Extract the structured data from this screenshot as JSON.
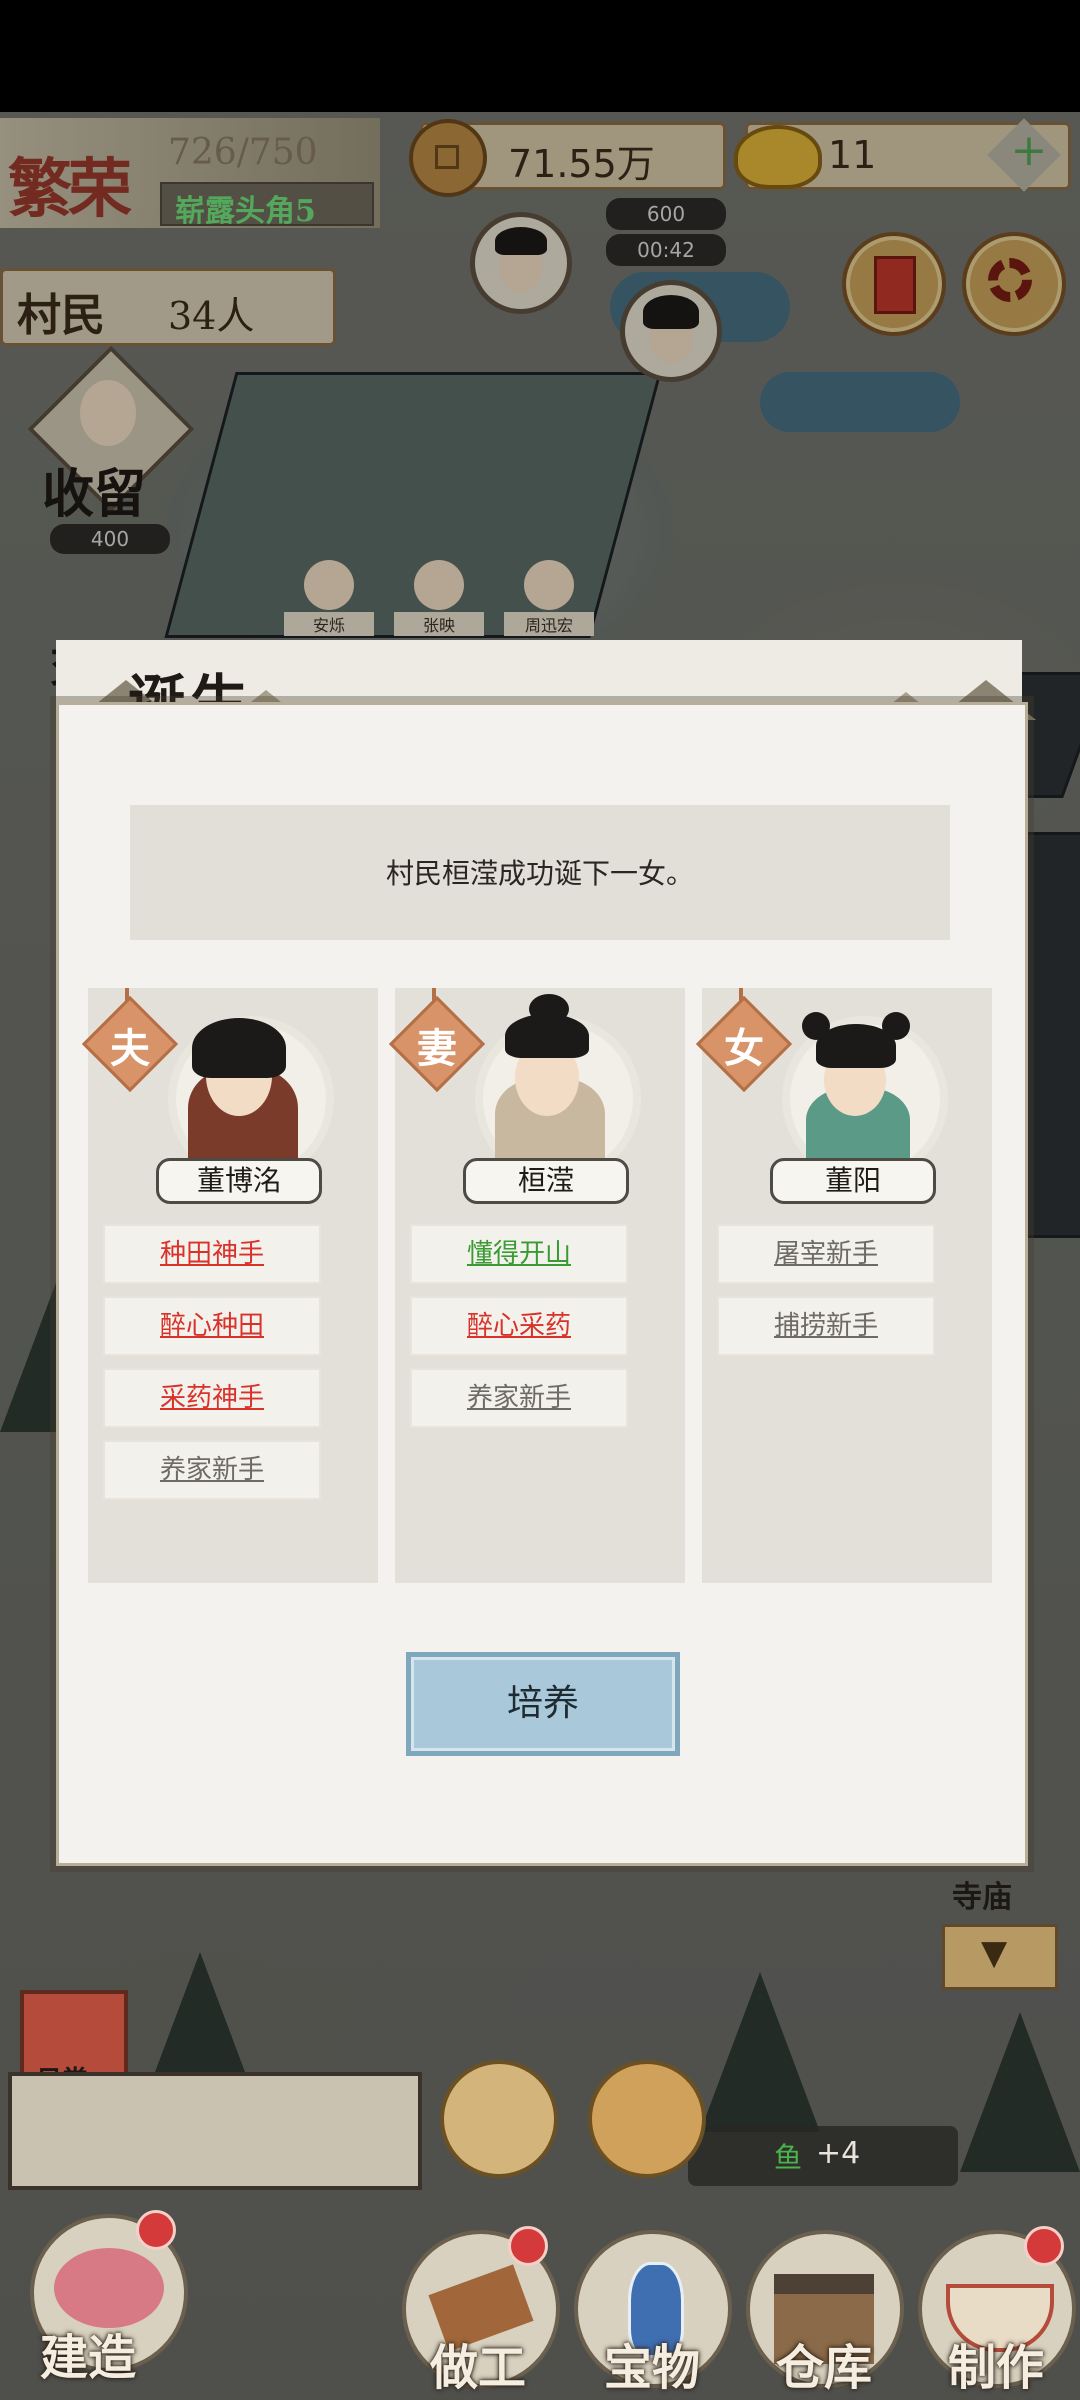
{
  "hud": {
    "rank_title": "繁荣",
    "prosperity": "726/750",
    "rank_level": "崭露头角5",
    "coins": "71.55万",
    "gold": "11",
    "villagers_label": "村民",
    "villagers_count": "34人",
    "shelter_label": "收留",
    "shelter_cost": "400",
    "trade_label": "交易",
    "visitor_cost": "600",
    "visitor_timer": "00:42",
    "temple_label": "寺庙",
    "daily_label": "日常",
    "fish_reward": "鱼",
    "fish_amount": "+4"
  },
  "map_names": [
    "安烁",
    "张映",
    "周迅宏"
  ],
  "modal": {
    "title": "诞生",
    "message": "村民桓滢成功诞下一女。",
    "cultivate_button": "培养",
    "cards": [
      {
        "role": "夫",
        "name": "董博洺",
        "traits": [
          {
            "label": "种田神手",
            "color": "red"
          },
          {
            "label": "醉心种田",
            "color": "red"
          },
          {
            "label": "采药神手",
            "color": "red"
          },
          {
            "label": "养家新手",
            "color": "gray"
          }
        ]
      },
      {
        "role": "妻",
        "name": "桓滢",
        "traits": [
          {
            "label": "懂得开山",
            "color": "green"
          },
          {
            "label": "醉心采药",
            "color": "red"
          },
          {
            "label": "养家新手",
            "color": "gray"
          }
        ]
      },
      {
        "role": "女",
        "name": "董阳",
        "traits": [
          {
            "label": "屠宰新手",
            "color": "gray"
          },
          {
            "label": "捕捞新手",
            "color": "gray"
          }
        ]
      }
    ]
  },
  "bottom_nav": {
    "build": "建造",
    "work": "做工",
    "treasure": "宝物",
    "warehouse": "仓库",
    "craft": "制作"
  },
  "colors": {
    "trait_red": "#d8322b",
    "trait_green": "#3a9a34",
    "trait_gray": "#6e6a64",
    "button_blue": "#a9c8d9"
  }
}
